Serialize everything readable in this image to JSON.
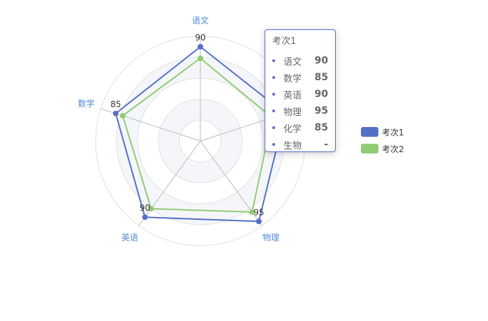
{
  "chart_data": {
    "type": "radar",
    "indicators": [
      "语文",
      "化学",
      "物理",
      "英语",
      "数学"
    ],
    "max": 100,
    "series": [
      {
        "name": "考次1",
        "color": "#5470c6",
        "values": [
          90,
          85,
          95,
          90,
          85
        ]
      },
      {
        "name": "考次2",
        "color": "#91cc75",
        "values": [
          79,
          72,
          84,
          80,
          78
        ]
      }
    ],
    "value_labels_series": 0,
    "legend": {
      "position": "right",
      "items": [
        "考次1",
        "考次2"
      ]
    }
  },
  "tooltip": {
    "title": "考次1",
    "dot_color": "#5470c6",
    "rows": [
      {
        "label": "语文",
        "value": "90"
      },
      {
        "label": "数学",
        "value": "85"
      },
      {
        "label": "英语",
        "value": "90"
      },
      {
        "label": "物理",
        "value": "95"
      },
      {
        "label": "化学",
        "value": "85"
      },
      {
        "label": "生物",
        "value": "-"
      }
    ]
  },
  "colors": {
    "axis_label": "#4c8bd6",
    "split_line": "#e0e0e0",
    "band_fill": "#f5f6fa"
  }
}
